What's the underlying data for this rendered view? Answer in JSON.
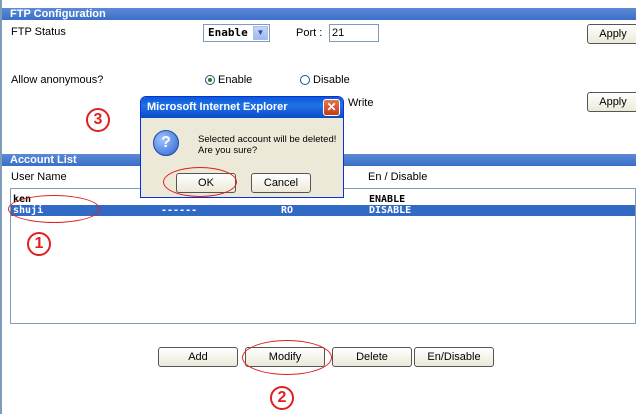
{
  "ftp_config": {
    "header": "FTP Configuration",
    "status_label": "FTP Status",
    "status_value": "Enable",
    "port_label": "Port :",
    "port_value": "21",
    "apply_label": "Apply",
    "anon_label": "Allow anonymous?",
    "anon_enable": "Enable",
    "anon_disable": "Disable",
    "write_label": "Write",
    "apply2_label": "Apply"
  },
  "account_list": {
    "header": "Account List",
    "col_user": "User Name",
    "col_endis": "En / Disable",
    "rows": [
      {
        "user": "ken",
        "dash": "",
        "perm": "",
        "state": "ENABLE",
        "selected": false
      },
      {
        "user": "shuji",
        "dash": "------",
        "perm": "RO",
        "state": "DISABLE",
        "selected": true
      }
    ]
  },
  "buttons": {
    "add": "Add",
    "modify": "Modify",
    "delete": "Delete",
    "endisable": "En/Disable"
  },
  "dialog": {
    "title": "Microsoft Internet Explorer",
    "close": "✕",
    "icon": "?",
    "message_line1": "Selected account will be deleted!",
    "message_line2": "Are you sure?",
    "ok": "OK",
    "cancel": "Cancel"
  },
  "annotations": {
    "step1": "1",
    "step2": "2",
    "step3": "3",
    "color": "#e02020"
  }
}
